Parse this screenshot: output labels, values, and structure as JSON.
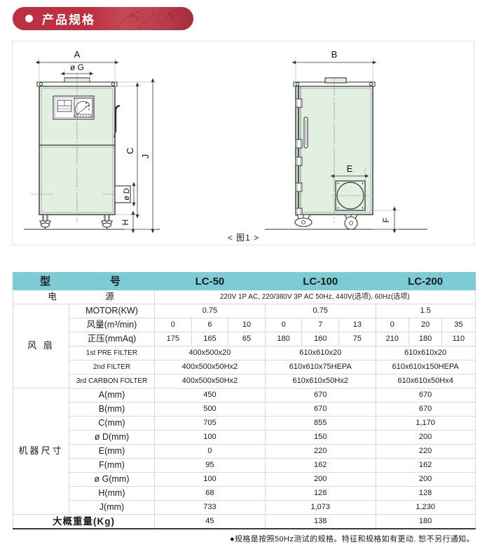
{
  "banner": {
    "title": "产品规格"
  },
  "figure": {
    "caption": "< 图1 >",
    "front_view_labels": {
      "A": "A",
      "G": "ø G",
      "C": "C",
      "J": "J",
      "D": "ø D",
      "H": "H"
    },
    "side_view_labels": {
      "B": "B",
      "E": "E",
      "F": "F"
    }
  },
  "table": {
    "header": {
      "label": "型　　　号",
      "models": [
        "LC-50",
        "LC-100",
        "LC-200"
      ]
    },
    "power": {
      "label": "电　　　源",
      "value": "220V 1P AC, 220/380V 3P AC 50Hz, 440V(选项), 60Hz(选项)"
    },
    "fan_group_label": "风 扇",
    "dim_group_label": "机器尺寸",
    "fan_rows": [
      {
        "label": "MOTOR(KW)",
        "span": true,
        "values": [
          "0.75",
          "0.75",
          "1.5"
        ]
      },
      {
        "label": "风量(m³/min)",
        "span": false,
        "values": [
          "0",
          "6",
          "10",
          "0",
          "7",
          "13",
          "0",
          "20",
          "35"
        ]
      },
      {
        "label": "正压(mmAq)",
        "span": false,
        "values": [
          "175",
          "165",
          "65",
          "180",
          "160",
          "75",
          "210",
          "180",
          "110"
        ]
      },
      {
        "label": "1st PRE FILTER",
        "span": true,
        "small": true,
        "values": [
          "400x500x20",
          "610x610x20",
          "610x610x20"
        ]
      },
      {
        "label": "2nd FILTER",
        "span": true,
        "small": true,
        "values": [
          "400x500x50Hx2",
          "610x610x75HEPA",
          "610x610x150HEPA"
        ]
      },
      {
        "label": "3rd CARBON FOLTER",
        "span": true,
        "small": true,
        "values": [
          "400x500x50Hx2",
          "610x610x50Hx2",
          "610x610x50Hx4"
        ]
      }
    ],
    "dim_rows": [
      {
        "label": "A(mm)",
        "values": [
          "450",
          "670",
          "670"
        ]
      },
      {
        "label": "B(mm)",
        "values": [
          "500",
          "670",
          "670"
        ]
      },
      {
        "label": "C(mm)",
        "values": [
          "705",
          "855",
          "1,170"
        ]
      },
      {
        "label": "ø D(mm)",
        "values": [
          "100",
          "150",
          "200"
        ]
      },
      {
        "label": "E(mm)",
        "values": [
          "0",
          "220",
          "220"
        ]
      },
      {
        "label": "F(mm)",
        "values": [
          "95",
          "162",
          "162"
        ]
      },
      {
        "label": "ø G(mm)",
        "values": [
          "100",
          "200",
          "200"
        ]
      },
      {
        "label": "H(mm)",
        "values": [
          "68",
          "128",
          "128"
        ]
      },
      {
        "label": "J(mm)",
        "values": [
          "733",
          "1,073",
          "1,230"
        ]
      }
    ],
    "weight_row": {
      "label": "大概重量(Kg)",
      "values": [
        "45",
        "138",
        "180"
      ]
    }
  },
  "footer": {
    "note": "●规格是按照50Hz测试的规格。特征和规格如有更动.  恕不另行通知。"
  },
  "colors": {
    "banner_red": "#bf2f42",
    "header_teal": "#7ccbd5",
    "cabinet_green": "#e2f0e2",
    "line_dark": "#3a3a3a"
  }
}
